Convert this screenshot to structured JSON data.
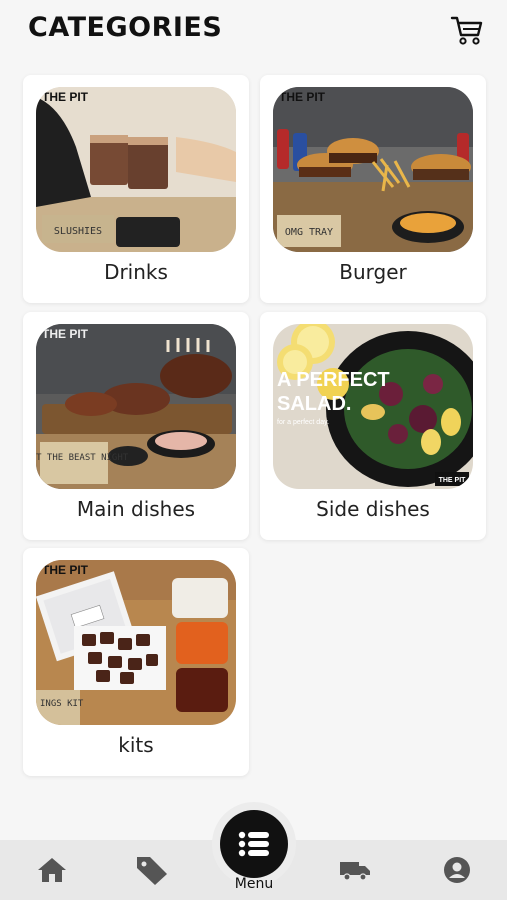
{
  "header": {
    "title": "CATEGORIES",
    "cart_icon": "shopping-cart-icon"
  },
  "categories": [
    {
      "label": "Drinks",
      "image_text": "THE PIT",
      "image_caption": "SLUSHIES"
    },
    {
      "label": "Burger",
      "image_text": "THE PIT",
      "image_caption": "OMG TRAY"
    },
    {
      "label": "Main dishes",
      "image_text": "THE PIT",
      "image_caption": "MEAT THE BEAST NIGHT"
    },
    {
      "label": "Side dishes",
      "image_text": "A PERFECT SALAD.",
      "image_caption": "for a perfect day.",
      "image_badge": "THE PIT"
    },
    {
      "label": "kits",
      "image_text": "THE PIT",
      "image_caption": "INGS KIT"
    }
  ],
  "bottom_nav": {
    "items": [
      {
        "icon": "home-icon"
      },
      {
        "icon": "tag-icon"
      },
      {
        "icon": "menu-list-icon",
        "label": "Menu"
      },
      {
        "icon": "truck-icon"
      },
      {
        "icon": "user-icon"
      }
    ]
  },
  "colors": {
    "background": "#f6f6f6",
    "card": "#ffffff",
    "nav_bar": "#e8e8e8",
    "menu_button": "#111111",
    "icons": "#555555"
  }
}
